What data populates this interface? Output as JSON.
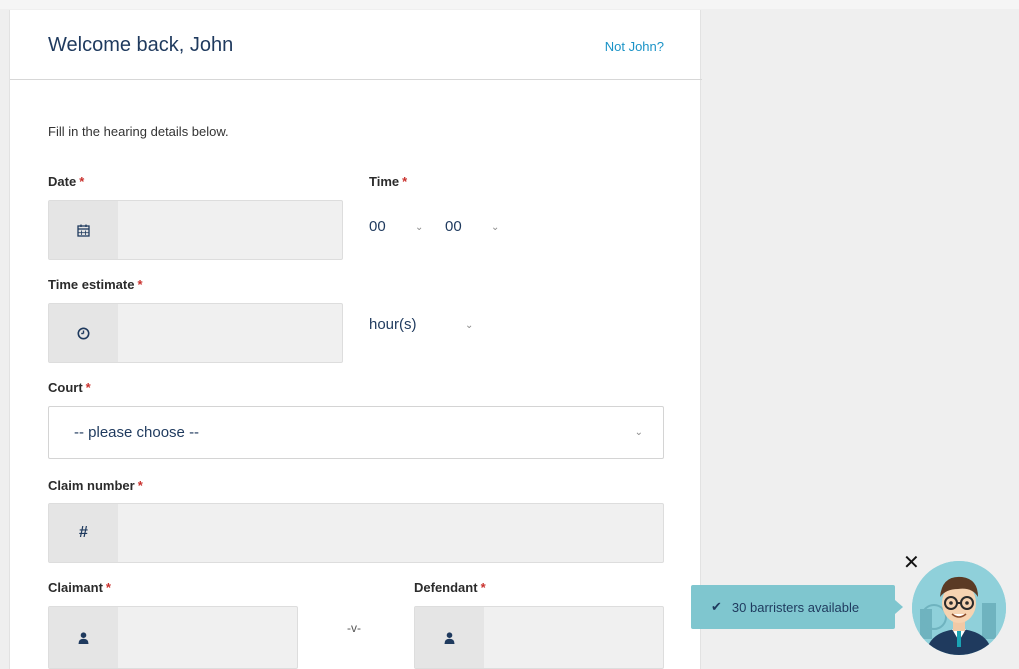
{
  "header": {
    "welcome": "Welcome back, John",
    "not_user_link": "Not John?"
  },
  "form": {
    "intro": "Fill in the hearing details below.",
    "required_marker": "*",
    "date": {
      "label": "Date",
      "value": ""
    },
    "time": {
      "label": "Time",
      "hours": "00",
      "minutes": "00"
    },
    "time_estimate": {
      "label": "Time estimate",
      "value": "",
      "unit": "hour(s)"
    },
    "court": {
      "label": "Court",
      "selected": "-- please choose --"
    },
    "claim_number": {
      "label": "Claim number",
      "value": "",
      "icon_text": "#"
    },
    "claimant": {
      "label": "Claimant",
      "value": ""
    },
    "versus": "-v-",
    "defendant": {
      "label": "Defendant",
      "value": ""
    }
  },
  "notification": {
    "text": "30 barristers available",
    "close_symbol": "✕"
  },
  "colors": {
    "accent": "#1a93c7",
    "primary_text": "#1f3a5e",
    "required": "#c9302c",
    "toast_bg": "#7fc6cf"
  },
  "icons": [
    "calendar-icon",
    "clock-icon",
    "hash-icon",
    "user-icon",
    "check-icon",
    "close-icon",
    "chevron-down-icon"
  ]
}
